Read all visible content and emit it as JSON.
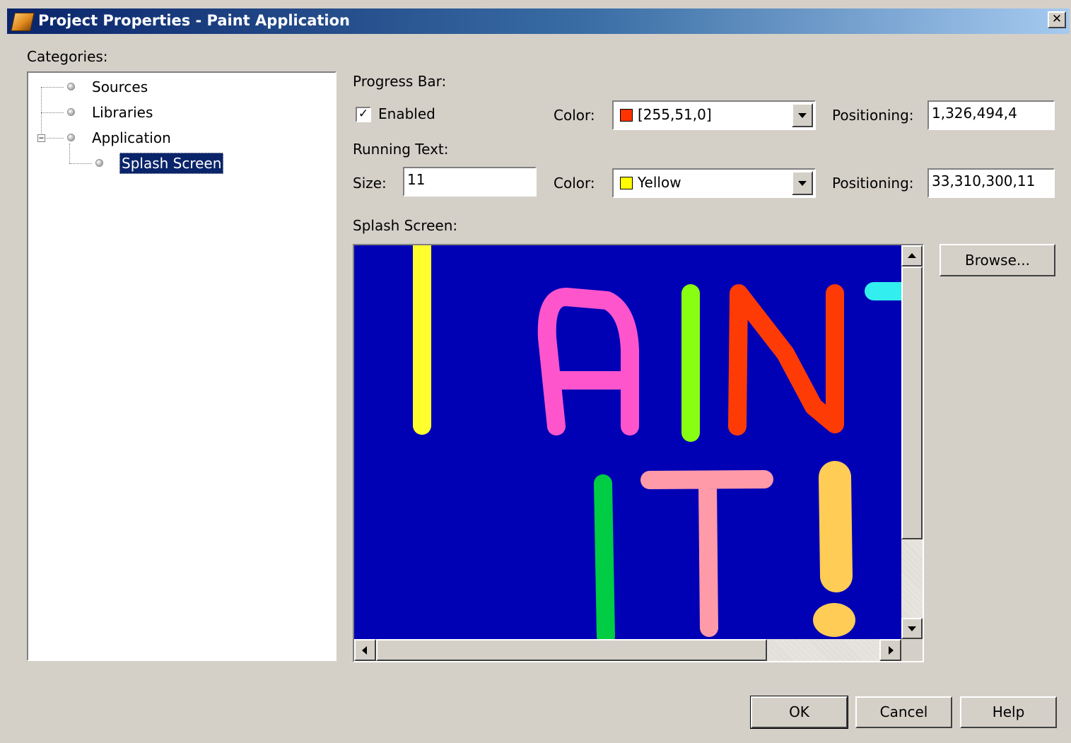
{
  "window": {
    "title": "Project Properties - Paint Application",
    "close_glyph": "✕"
  },
  "categories": {
    "label": "Categories:",
    "items": [
      {
        "label": "Sources"
      },
      {
        "label": "Libraries"
      },
      {
        "label": "Application",
        "expander": "−"
      },
      {
        "label": "Splash Screen",
        "selected": true
      }
    ]
  },
  "progress_bar": {
    "section_label": "Progress Bar:",
    "enabled_label": "Enabled",
    "enabled_checked": true,
    "check_glyph": "✓",
    "color_label": "Color:",
    "color_value": "[255,51,0]",
    "color_swatch": "#ff3300",
    "positioning_label": "Positioning:",
    "positioning_value": "1,326,494,4"
  },
  "running_text": {
    "section_label": "Running Text:",
    "size_label": "Size:",
    "size_value": "11",
    "color_label": "Color:",
    "color_value": "Yellow",
    "color_swatch": "#ffff00",
    "positioning_label": "Positioning:",
    "positioning_value": "33,310,300,11"
  },
  "splash_screen": {
    "section_label": "Splash Screen:",
    "browse_label": "Browse...",
    "background": "#0000b4",
    "art_colors": {
      "p": "#ffff2e",
      "a": "#ff55cc",
      "i": "#88ff11",
      "n": "#ff3b05",
      "t_partial": "#33eeee",
      "i2": "#00cc44",
      "t": "#ff9aa8",
      "exclaim": "#ffcc55"
    }
  },
  "footer": {
    "ok_label": "OK",
    "cancel_label": "Cancel",
    "help_label": "Help"
  }
}
